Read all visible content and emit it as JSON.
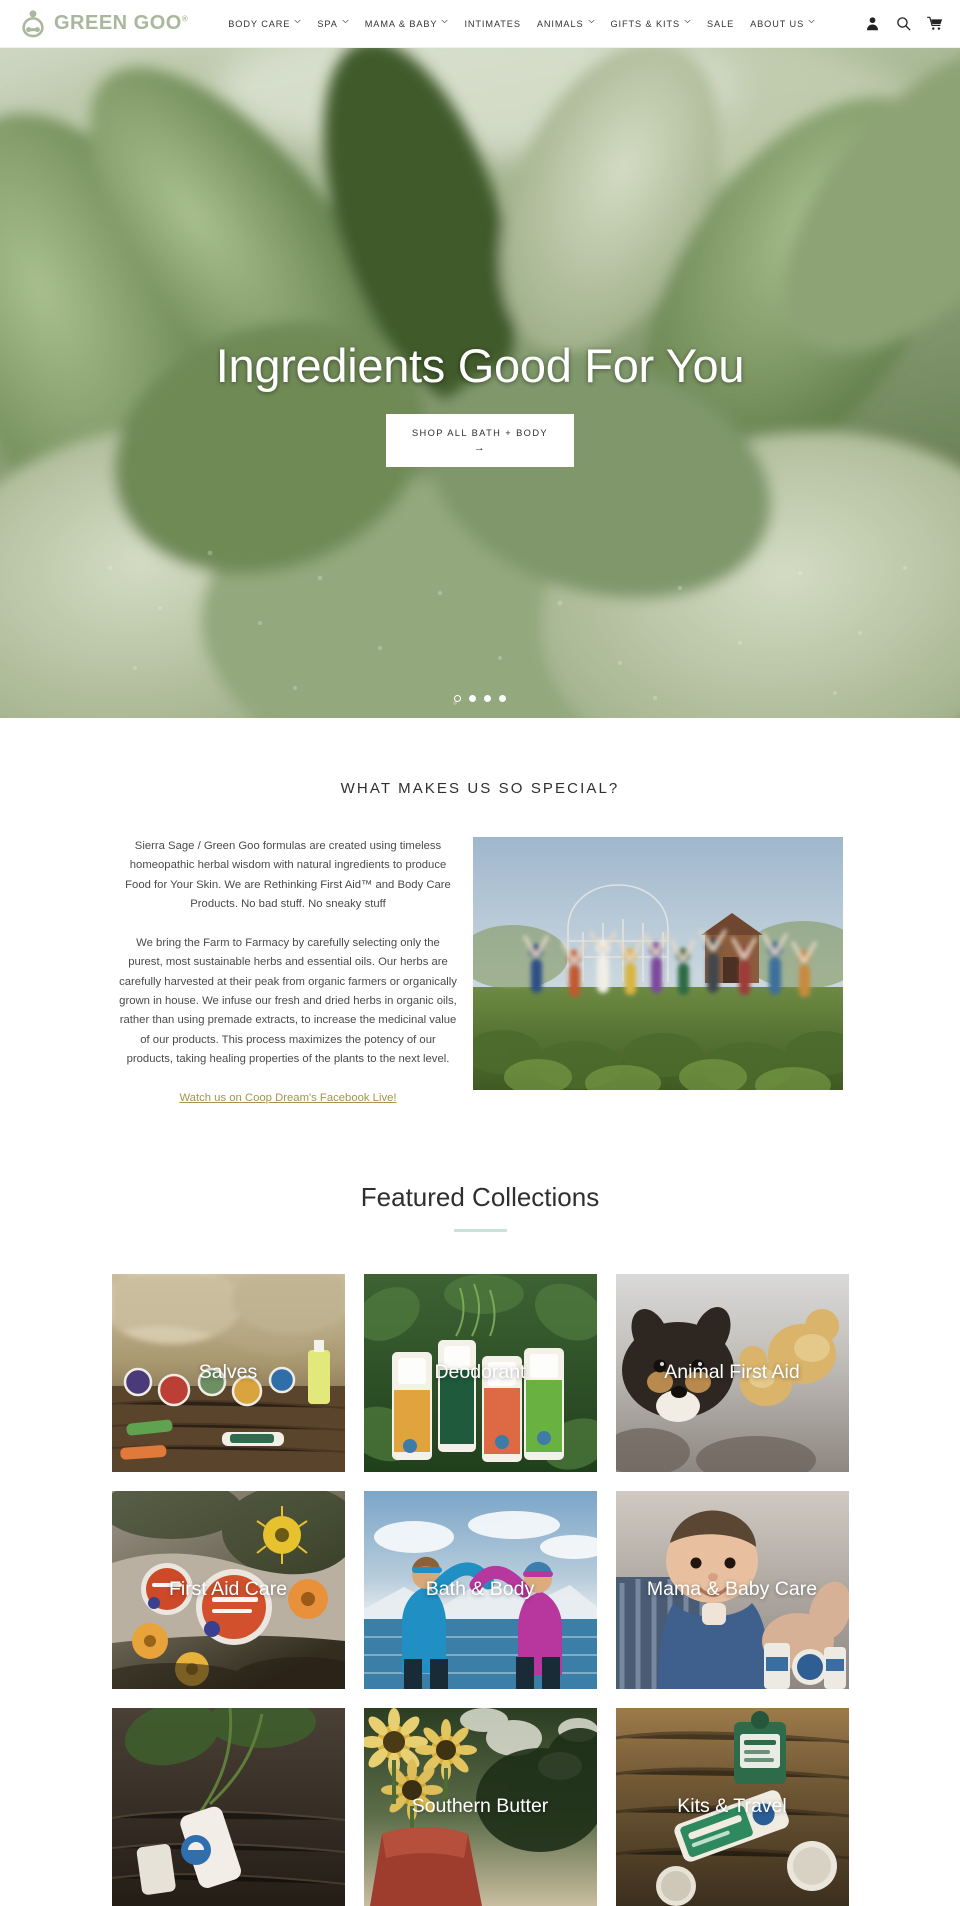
{
  "header": {
    "brand_name": "GREEN GOO",
    "brand_registered": "®",
    "logo_icon": "green-goo-person-logo",
    "nav": [
      {
        "label": "BODY CARE",
        "has_dropdown": true
      },
      {
        "label": "SPA",
        "has_dropdown": true
      },
      {
        "label": "MAMA & BABY",
        "has_dropdown": true
      },
      {
        "label": "INTIMATES",
        "has_dropdown": false
      },
      {
        "label": "ANIMALS",
        "has_dropdown": true
      },
      {
        "label": "GIFTS & KITS",
        "has_dropdown": true
      },
      {
        "label": "SALE",
        "has_dropdown": false
      },
      {
        "label": "ABOUT US",
        "has_dropdown": true
      }
    ],
    "icons": [
      {
        "name": "account-icon",
        "glyph": "person"
      },
      {
        "name": "search-icon",
        "glyph": "magnifier"
      },
      {
        "name": "cart-icon",
        "glyph": "shopping-cart"
      }
    ]
  },
  "hero": {
    "title": "Ingredients Good For You",
    "cta_label": "SHOP ALL BATH + BODY",
    "cta_arrow": "→",
    "slides_total": 4,
    "active_slide": 1,
    "background_alt": "close-up of fuzzy green sage leaves"
  },
  "special": {
    "title": "WHAT MAKES US SO SPECIAL?",
    "paragraphs": [
      "Sierra Sage / Green Goo formulas are created using timeless homeopathic herbal wisdom with natural ingredients to produce Food for Your Skin. We are Rethinking First Aid™ and Body Care Products. No bad stuff. No sneaky stuff",
      "We bring the Farm to Farmacy by carefully selecting only the purest, most sustainable herbs and essential oils. Our herbs are carefully harvested at their peak from organic farmers or organically grown in house. We infuse our fresh and dried herbs in organic oils, rather than using premade extracts, to increase the medicinal value of our products. This process maximizes the potency of our products, taking healing properties of the plants to the next level."
    ],
    "link_label": "Watch us on Coop Dream's Facebook Live!",
    "link_color": "#a98f52",
    "photo_alt": "team of people jumping in a garden greenhouse"
  },
  "featured": {
    "title": "Featured Collections",
    "rule_color": "#c9e3dc",
    "collections": [
      {
        "label": "Salves",
        "image_alt": "salve tins and lip balms on a log"
      },
      {
        "label": "Deodorant",
        "image_alt": "green goo deodorant sticks among herbs"
      },
      {
        "label": "Animal First Aid",
        "image_alt": "puppy with baby chicks"
      },
      {
        "label": "First Aid Care",
        "image_alt": "first aid tins by wildflowers"
      },
      {
        "label": "Bath & Body",
        "image_alt": "two hikers making a heart shape"
      },
      {
        "label": "Mama & Baby Care",
        "image_alt": "baby with balm products"
      },
      {
        "label": "",
        "image_alt": "tube product in garden soil"
      },
      {
        "label": "Southern Butter",
        "image_alt": "sunflowers in a red pail"
      },
      {
        "label": "Kits & Travel",
        "image_alt": "travel deodorant and tins on wood"
      }
    ]
  }
}
